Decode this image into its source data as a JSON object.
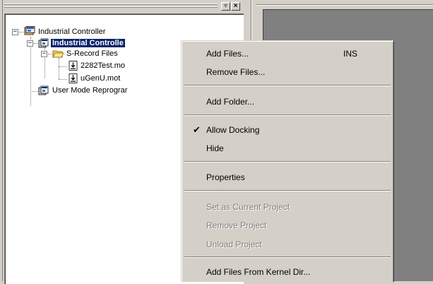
{
  "tree": {
    "items": [
      {
        "label": "Industrial Controller"
      },
      {
        "label": "Industrial Controlle"
      },
      {
        "label": "S-Record Files"
      },
      {
        "label": "2282Test.mo"
      },
      {
        "label": "uGenU.mot"
      },
      {
        "label": "User Mode Reprograr"
      }
    ]
  },
  "pane_buttons": {
    "restore": "▾",
    "close": "×"
  },
  "context_menu": {
    "items": [
      {
        "label": "Add Files...",
        "shortcut": "INS",
        "enabled": true
      },
      {
        "label": "Remove Files...",
        "enabled": true
      },
      {
        "label": "Add Folder...",
        "enabled": true
      },
      {
        "label": "Allow Docking",
        "checked": true,
        "enabled": true
      },
      {
        "label": "Hide",
        "enabled": true
      },
      {
        "label": "Properties",
        "enabled": true
      },
      {
        "label": "Set as Current Project",
        "enabled": false
      },
      {
        "label": "Remove Project",
        "enabled": false
      },
      {
        "label": "Unload Project",
        "enabled": false
      },
      {
        "label": "Add Files From Kernel Dir...",
        "enabled": true
      }
    ],
    "check_glyph": "✔"
  },
  "colors": {
    "selection": "#0a246a",
    "face": "#d4d0c8",
    "disabled_text": "#808080"
  }
}
